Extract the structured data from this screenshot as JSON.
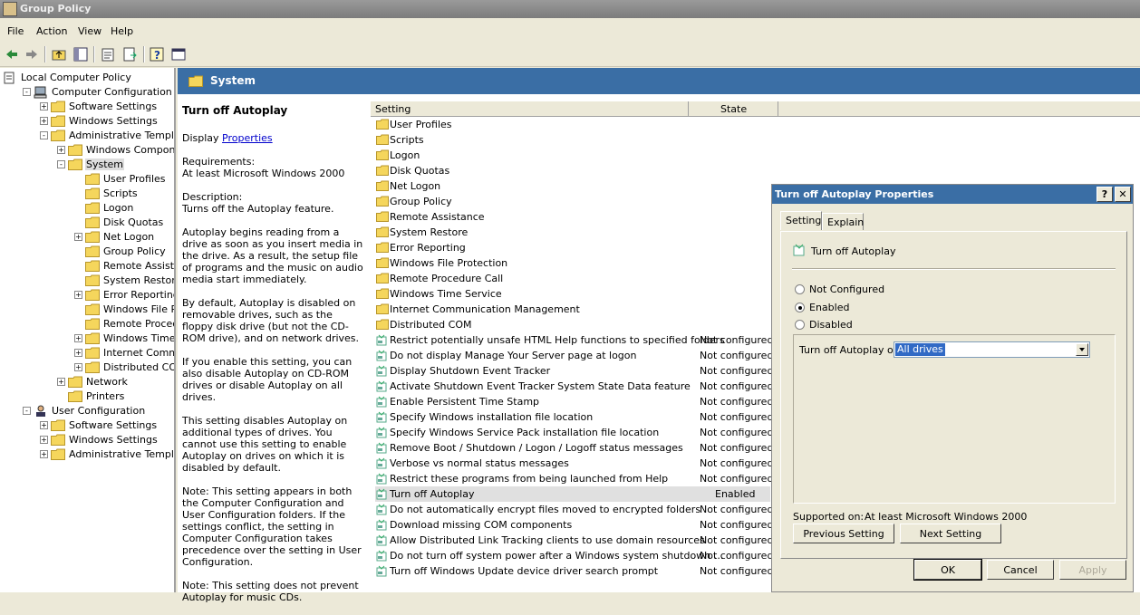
{
  "window": {
    "title": "Group Policy"
  },
  "menu": [
    "File",
    "Action",
    "View",
    "Help"
  ],
  "tree": [
    {
      "label": "Local Computer Policy",
      "indent": 0,
      "expander": "",
      "icon": "policy"
    },
    {
      "label": "Computer Configuration",
      "indent": 1,
      "expander": "-",
      "icon": "computer"
    },
    {
      "label": "Software Settings",
      "indent": 2,
      "expander": "+",
      "icon": "folder"
    },
    {
      "label": "Windows Settings",
      "indent": 2,
      "expander": "+",
      "icon": "folder"
    },
    {
      "label": "Administrative Templates",
      "indent": 2,
      "expander": "-",
      "icon": "folder"
    },
    {
      "label": "Windows Components",
      "indent": 3,
      "expander": "+",
      "icon": "folder"
    },
    {
      "label": "System",
      "indent": 3,
      "expander": "-",
      "icon": "folder",
      "selected": true
    },
    {
      "label": "User Profiles",
      "indent": 4,
      "expander": "",
      "icon": "folder"
    },
    {
      "label": "Scripts",
      "indent": 4,
      "expander": "",
      "icon": "folder"
    },
    {
      "label": "Logon",
      "indent": 4,
      "expander": "",
      "icon": "folder"
    },
    {
      "label": "Disk Quotas",
      "indent": 4,
      "expander": "",
      "icon": "folder"
    },
    {
      "label": "Net Logon",
      "indent": 4,
      "expander": "+",
      "icon": "folder"
    },
    {
      "label": "Group Policy",
      "indent": 4,
      "expander": "",
      "icon": "folder"
    },
    {
      "label": "Remote Assistance",
      "indent": 4,
      "expander": "",
      "icon": "folder"
    },
    {
      "label": "System Restore",
      "indent": 4,
      "expander": "",
      "icon": "folder"
    },
    {
      "label": "Error Reporting",
      "indent": 4,
      "expander": "+",
      "icon": "folder"
    },
    {
      "label": "Windows File Prote",
      "indent": 4,
      "expander": "",
      "icon": "folder"
    },
    {
      "label": "Remote Procedure",
      "indent": 4,
      "expander": "",
      "icon": "folder"
    },
    {
      "label": "Windows Time Serv",
      "indent": 4,
      "expander": "+",
      "icon": "folder"
    },
    {
      "label": "Internet Communic",
      "indent": 4,
      "expander": "+",
      "icon": "folder"
    },
    {
      "label": "Distributed COM",
      "indent": 4,
      "expander": "+",
      "icon": "folder"
    },
    {
      "label": "Network",
      "indent": 3,
      "expander": "+",
      "icon": "folder"
    },
    {
      "label": "Printers",
      "indent": 3,
      "expander": "",
      "icon": "folder"
    },
    {
      "label": "User Configuration",
      "indent": 1,
      "expander": "-",
      "icon": "user"
    },
    {
      "label": "Software Settings",
      "indent": 2,
      "expander": "+",
      "icon": "folder"
    },
    {
      "label": "Windows Settings",
      "indent": 2,
      "expander": "+",
      "icon": "folder"
    },
    {
      "label": "Administrative Templates",
      "indent": 2,
      "expander": "+",
      "icon": "folder"
    }
  ],
  "banner": {
    "title": "System"
  },
  "description": {
    "heading": "Turn off Autoplay",
    "display_prefix": "Display ",
    "display_link": "Properties",
    "paragraphs": [
      "Requirements:\nAt least Microsoft Windows 2000",
      "Description:\nTurns off the Autoplay feature.",
      "Autoplay begins reading from a drive as soon as you insert media in the drive. As a result, the setup file of programs and the music on audio media start immediately.",
      "By default, Autoplay is disabled on removable drives, such as the floppy disk drive (but not the CD-ROM drive), and on network drives.",
      "If you enable this setting, you can also disable Autoplay on CD-ROM drives or disable Autoplay on all drives.",
      "This setting disables Autoplay on additional types of drives. You cannot use this setting to enable Autoplay on drives on which it is disabled by default.",
      "Note: This setting appears in both the Computer Configuration and User Configuration folders. If the settings conflict, the setting in Computer Configuration takes precedence over the setting in User Configuration.",
      "Note: This setting does not prevent Autoplay for music CDs."
    ]
  },
  "list": {
    "col_setting": "Setting",
    "col_state": "State",
    "rows": [
      {
        "name": "User Profiles",
        "state": "",
        "type": "folder"
      },
      {
        "name": "Scripts",
        "state": "",
        "type": "folder"
      },
      {
        "name": "Logon",
        "state": "",
        "type": "folder"
      },
      {
        "name": "Disk Quotas",
        "state": "",
        "type": "folder"
      },
      {
        "name": "Net Logon",
        "state": "",
        "type": "folder"
      },
      {
        "name": "Group Policy",
        "state": "",
        "type": "folder"
      },
      {
        "name": "Remote Assistance",
        "state": "",
        "type": "folder"
      },
      {
        "name": "System Restore",
        "state": "",
        "type": "folder"
      },
      {
        "name": "Error Reporting",
        "state": "",
        "type": "folder"
      },
      {
        "name": "Windows File Protection",
        "state": "",
        "type": "folder"
      },
      {
        "name": "Remote Procedure Call",
        "state": "",
        "type": "folder"
      },
      {
        "name": "Windows Time Service",
        "state": "",
        "type": "folder"
      },
      {
        "name": "Internet Communication Management",
        "state": "",
        "type": "folder"
      },
      {
        "name": "Distributed COM",
        "state": "",
        "type": "folder"
      },
      {
        "name": "Restrict potentially unsafe HTML Help functions to specified folders",
        "state": "Not configured",
        "type": "policy"
      },
      {
        "name": "Do not display Manage Your Server page at logon",
        "state": "Not configured",
        "type": "policy"
      },
      {
        "name": "Display Shutdown Event Tracker",
        "state": "Not configured",
        "type": "policy"
      },
      {
        "name": "Activate Shutdown Event Tracker System State Data feature",
        "state": "Not configured",
        "type": "policy"
      },
      {
        "name": "Enable Persistent Time Stamp",
        "state": "Not configured",
        "type": "policy"
      },
      {
        "name": "Specify Windows installation file location",
        "state": "Not configured",
        "type": "policy"
      },
      {
        "name": "Specify Windows Service Pack installation file location",
        "state": "Not configured",
        "type": "policy"
      },
      {
        "name": "Remove Boot / Shutdown / Logon / Logoff status messages",
        "state": "Not configured",
        "type": "policy"
      },
      {
        "name": "Verbose vs normal status messages",
        "state": "Not configured",
        "type": "policy"
      },
      {
        "name": "Restrict these programs from being launched from Help",
        "state": "Not configured",
        "type": "policy"
      },
      {
        "name": "Turn off Autoplay",
        "state": "Enabled",
        "type": "policy",
        "highlight": true
      },
      {
        "name": "Do not automatically encrypt files moved to encrypted folders",
        "state": "Not configured",
        "type": "policy"
      },
      {
        "name": "Download missing COM components",
        "state": "Not configured",
        "type": "policy"
      },
      {
        "name": "Allow Distributed Link Tracking clients to use domain resources",
        "state": "Not configured",
        "type": "policy"
      },
      {
        "name": "Do not turn off system power after a Windows system shutdown …",
        "state": "Not configured",
        "type": "policy"
      },
      {
        "name": "Turn off Windows Update device driver search prompt",
        "state": "Not configured",
        "type": "policy"
      }
    ]
  },
  "dialog": {
    "title": "Turn off Autoplay Properties",
    "help_btn": "?",
    "close_btn": "✕",
    "tabs": [
      "Setting",
      "Explain"
    ],
    "policy_name": "Turn off Autoplay",
    "options": [
      {
        "label": "Not Configured",
        "checked": false
      },
      {
        "label": "Enabled",
        "checked": true
      },
      {
        "label": "Disabled",
        "checked": false
      }
    ],
    "autoplay_label": "Turn off Autoplay on:",
    "autoplay_value": "All drives",
    "supported_label": "Supported on:",
    "supported_value": "At least Microsoft Windows 2000",
    "prev_btn": "Previous Setting",
    "next_btn": "Next Setting",
    "ok_btn": "OK",
    "cancel_btn": "Cancel",
    "apply_btn": "Apply"
  }
}
